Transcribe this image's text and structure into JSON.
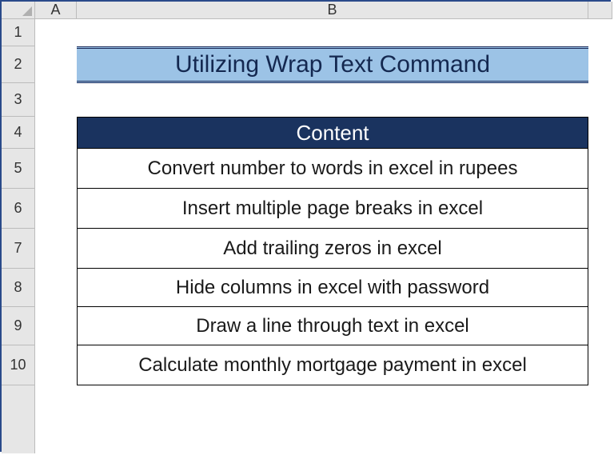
{
  "columns": {
    "A": "A",
    "B": "B"
  },
  "rows": [
    "1",
    "2",
    "3",
    "4",
    "5",
    "6",
    "7",
    "8",
    "9",
    "10"
  ],
  "title": "Utilizing Wrap Text Command",
  "table": {
    "header": "Content",
    "rows": [
      "Convert number to words in excel in rupees",
      "Insert multiple page breaks in excel",
      "Add trailing zeros in excel",
      "Hide columns in excel with password",
      "Draw a line through text in excel",
      "Calculate monthly mortgage payment in excel"
    ]
  }
}
